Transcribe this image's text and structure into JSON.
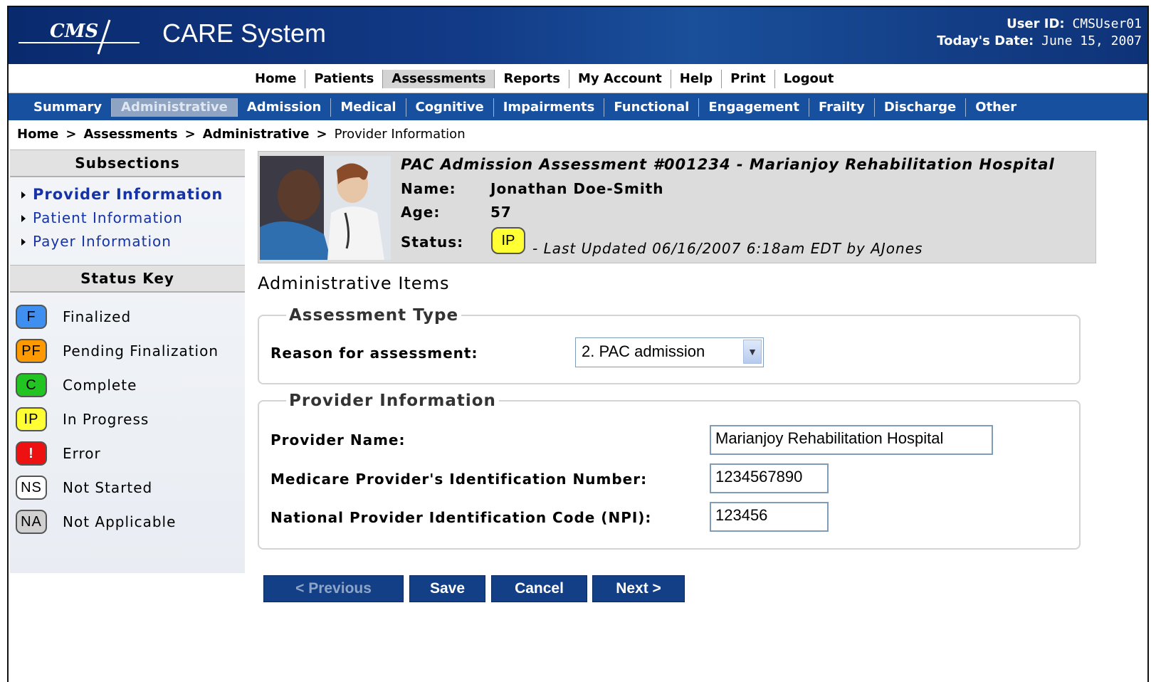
{
  "header": {
    "logo_text": "CMS",
    "app_title": "CARE System",
    "user_id_label": "User ID:",
    "user_id": "CMSUser01",
    "date_label": "Today's Date:",
    "date": "June 15, 2007"
  },
  "topnav": [
    "Home",
    "Patients",
    "Assessments",
    "Reports",
    "My Account",
    "Help",
    "Print",
    "Logout"
  ],
  "topnav_active": "Assessments",
  "subnav": [
    "Summary",
    "Administrative",
    "Admission",
    "Medical",
    "Cognitive",
    "Impairments",
    "Functional",
    "Engagement",
    "Frailty",
    "Discharge",
    "Other"
  ],
  "subnav_active": "Administrative",
  "breadcrumb": [
    "Home",
    "Assessments",
    "Administrative",
    "Provider Information"
  ],
  "sidebar": {
    "subsections_title": "Subsections",
    "subsections": [
      "Provider Information",
      "Patient Information",
      "Payer Information"
    ],
    "status_key_title": "Status Key",
    "status_key": [
      {
        "code": "F",
        "label": "Finalized",
        "color": "#3f8ff0"
      },
      {
        "code": "PF",
        "label": "Pending Finalization",
        "color": "#ff9900"
      },
      {
        "code": "C",
        "label": "Complete",
        "color": "#22c422"
      },
      {
        "code": "IP",
        "label": "In Progress",
        "color": "#ffff33"
      },
      {
        "code": "!",
        "label": "Error",
        "color": "#ee1111"
      },
      {
        "code": "NS",
        "label": "Not Started",
        "color": "#ffffff"
      },
      {
        "code": "NA",
        "label": "Not Applicable",
        "color": "#d0d0d0"
      }
    ]
  },
  "patient": {
    "title": "PAC Admission Assessment #001234 - Marianjoy Rehabilitation Hospital",
    "name_label": "Name:",
    "name": "Jonathan Doe-Smith",
    "age_label": "Age:",
    "age": "57",
    "status_label": "Status:",
    "status_code": "IP",
    "last_updated": "- Last Updated 06/16/2007 6:18am EDT by AJones"
  },
  "main": {
    "title": "Administrative Items",
    "assessment_type": {
      "legend": "Assessment Type",
      "reason_label": "Reason for assessment:",
      "reason_value": "2. PAC admission"
    },
    "provider_info": {
      "legend": "Provider Information",
      "provider_name_label": "Provider Name:",
      "provider_name": "Marianjoy Rehabilitation Hospital",
      "medicare_label": "Medicare Provider's Identification Number:",
      "medicare_value": "1234567890",
      "npi_label": "National Provider Identification Code (NPI):",
      "npi_value": "123456"
    }
  },
  "buttons": {
    "previous": "< Previous",
    "save": "Save",
    "cancel": "Cancel",
    "next": "Next >"
  }
}
